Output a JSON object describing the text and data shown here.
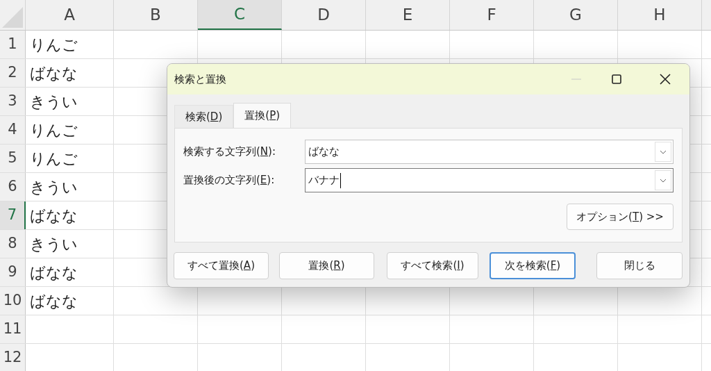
{
  "sheet": {
    "columns": [
      {
        "label": "A",
        "selected": false
      },
      {
        "label": "B",
        "selected": false
      },
      {
        "label": "C",
        "selected": true
      },
      {
        "label": "D",
        "selected": false
      },
      {
        "label": "E",
        "selected": false
      },
      {
        "label": "F",
        "selected": false
      },
      {
        "label": "G",
        "selected": false
      },
      {
        "label": "H",
        "selected": false
      }
    ],
    "rows": [
      {
        "label": "1",
        "selected": false,
        "cells": [
          "りんご"
        ]
      },
      {
        "label": "2",
        "selected": false,
        "cells": [
          "ばなな"
        ]
      },
      {
        "label": "3",
        "selected": false,
        "cells": [
          "きうい"
        ]
      },
      {
        "label": "4",
        "selected": false,
        "cells": [
          "りんご"
        ]
      },
      {
        "label": "5",
        "selected": false,
        "cells": [
          "りんご"
        ]
      },
      {
        "label": "6",
        "selected": false,
        "cells": [
          "きうい"
        ]
      },
      {
        "label": "7",
        "selected": true,
        "cells": [
          "ばなな"
        ]
      },
      {
        "label": "8",
        "selected": false,
        "cells": [
          "きうい"
        ]
      },
      {
        "label": "9",
        "selected": false,
        "cells": [
          "ばなな"
        ]
      },
      {
        "label": "10",
        "selected": false,
        "cells": [
          "ばなな"
        ]
      },
      {
        "label": "11",
        "selected": false,
        "cells": []
      },
      {
        "label": "12",
        "selected": false,
        "cells": []
      }
    ]
  },
  "dialog": {
    "title": "検索と置換",
    "minimize_disabled": true,
    "tabs": [
      {
        "before": "検索(",
        "key": "D",
        "after": ")",
        "selected": false
      },
      {
        "before": "置換(",
        "key": "P",
        "after": ")",
        "selected": true
      }
    ],
    "fields": [
      {
        "before": "検索する文字列(",
        "key": "N",
        "after": "):",
        "value": "ばなな",
        "focused": false
      },
      {
        "before": "置換後の文字列(",
        "key": "E",
        "after": "):",
        "value": "バナナ",
        "focused": true
      }
    ],
    "options_button": {
      "before": "オプション(",
      "key": "T",
      "after": ") >>"
    },
    "buttons": [
      {
        "before": "すべて置換(",
        "key": "A",
        "after": ")",
        "default": false
      },
      {
        "before": "置換(",
        "key": "R",
        "after": ")",
        "default": false
      },
      {
        "before": "すべて検索(",
        "key": "I",
        "after": ")",
        "default": false
      },
      {
        "before": "次を検索(",
        "key": "F",
        "after": ")",
        "default": true
      },
      {
        "before": "閉じる",
        "default": false
      }
    ]
  }
}
